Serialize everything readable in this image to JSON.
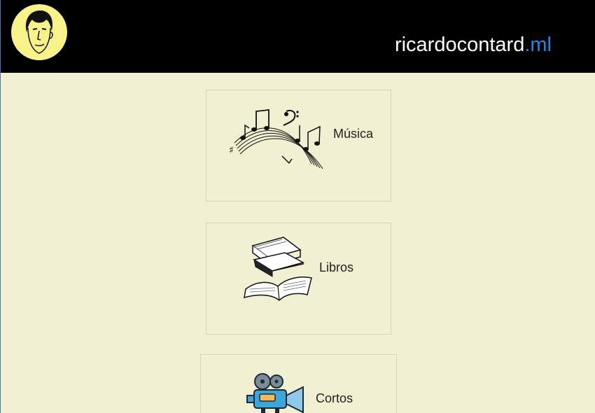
{
  "header": {
    "site_name": "ricardocontard",
    "site_tld": ".ml",
    "logo_icon": "face-caricature-icon"
  },
  "sections": [
    {
      "label": "Música",
      "icon": "music-notes-icon"
    },
    {
      "label": "Libros",
      "icon": "books-icon"
    },
    {
      "label": "Cortos",
      "icon": "movie-camera-icon"
    }
  ],
  "colors": {
    "header_bg": "#000000",
    "page_bg": "#f2f0d2",
    "tld_accent": "#1e88e5",
    "avatar_bg": "#f8f28a"
  }
}
